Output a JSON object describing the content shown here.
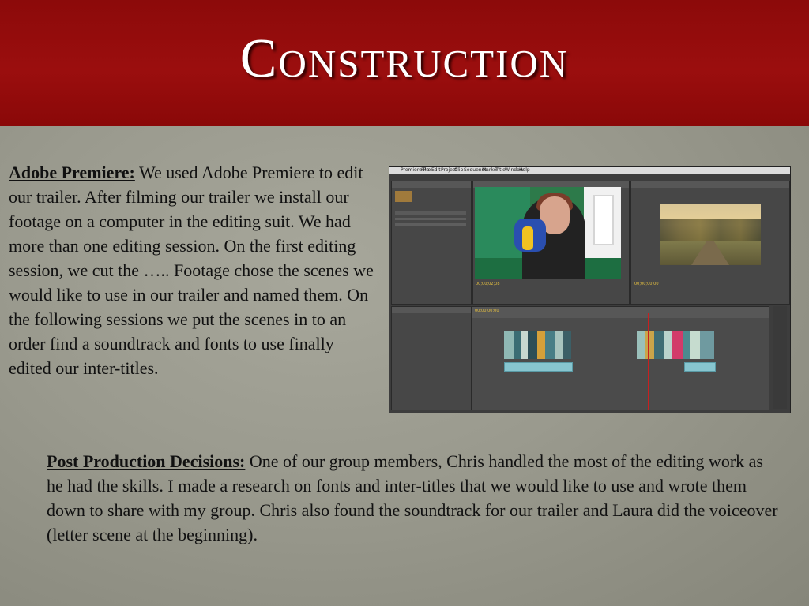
{
  "title": "Construction",
  "paragraph1": {
    "lead": "Adobe Premiere:",
    "text": " We used Adobe Premiere to edit our trailer. After filming our trailer we install our footage on a computer in the editing suit. We had more than one editing session. On the first editing session, we cut the ….. Footage chose the scenes we would like to use in our trailer and named them. On the following sessions we put the scenes in to an order find a soundtrack and fonts to use finally edited our inter-titles."
  },
  "paragraph2": {
    "lead": "Post Production Decisions:",
    "text": " One of our group members, Chris handled the most of the editing work as he had the skills. I made a research on fonts and inter-titles that we would like to use and wrote them down to share with my group. Chris also found the soundtrack for our trailer and Laura did the voiceover (letter scene at the beginning)."
  },
  "screenshot": {
    "menu": [
      "Premiere Pro",
      "File",
      "Edit",
      "Project",
      "Clip",
      "Sequence",
      "Marker",
      "Title",
      "Window",
      "Help"
    ],
    "source_timecode": "00;00;02;08",
    "program_timecode": "00;00;00;00",
    "timeline_timecode": "00;00;00;00"
  },
  "colors": {
    "header": "#9b0e0e",
    "background": "#9a9a8e"
  }
}
